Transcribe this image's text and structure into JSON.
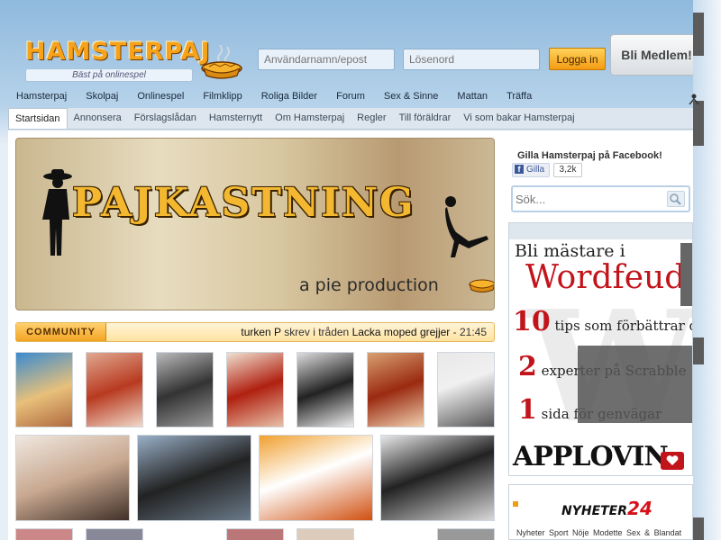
{
  "header": {
    "logo_text": "HAMSTERPAJ",
    "tagline": "Bäst på onlinespel",
    "username_placeholder": "Användarnamn/epost",
    "password_placeholder": "Lösenord",
    "login_label": "Logga in",
    "member_label": "Bli Medlem!"
  },
  "nav": {
    "items": [
      "Hamsterpaj",
      "Skolpaj",
      "Onlinespel",
      "Filmklipp",
      "Roliga Bilder",
      "Forum",
      "Sex & Sinne",
      "Mattan",
      "Träffa"
    ]
  },
  "subnav": {
    "items": [
      "Startsidan",
      "Annonsera",
      "Förslagslådan",
      "Hamsternytt",
      "Om Hamsterpaj",
      "Regler",
      "Till föräldrar",
      "Vi som bakar Hamsterpaj"
    ],
    "active": "Startsidan"
  },
  "banner": {
    "title": "PAJKASTNING",
    "subtitle": "a pie production"
  },
  "community": {
    "label": "COMMUNITY",
    "user": "turken P",
    "action": "skrev i tråden",
    "thread": "Lacka moped grejjer",
    "time": "- 21:45"
  },
  "sidebar": {
    "fb_title": "Gilla Hamsterpaj på Facebook!",
    "fb_like": "Gilla",
    "fb_count": "3,2k",
    "search_placeholder": "Sök...",
    "ad": {
      "line1": "Bli mästare i",
      "line2": "Wordfeud",
      "line3_num": "10",
      "line3_text": "tips som förbättrar dig",
      "line4_num": "2",
      "line4_text": "experter på Scrabble",
      "line5_num": "1",
      "line5_text": "sida för genvägar",
      "brand": "APPLOVIN"
    },
    "news": {
      "logo_prefix": "NYHETER",
      "logo_num": "24",
      "tabs": "Nyheter  Sport  Nöje  Modette  Sex & Blandat"
    }
  },
  "colors": {
    "accent_orange": "#f39b11",
    "sky_blue": "#8fb9dd",
    "ad_red": "#c2141b"
  }
}
